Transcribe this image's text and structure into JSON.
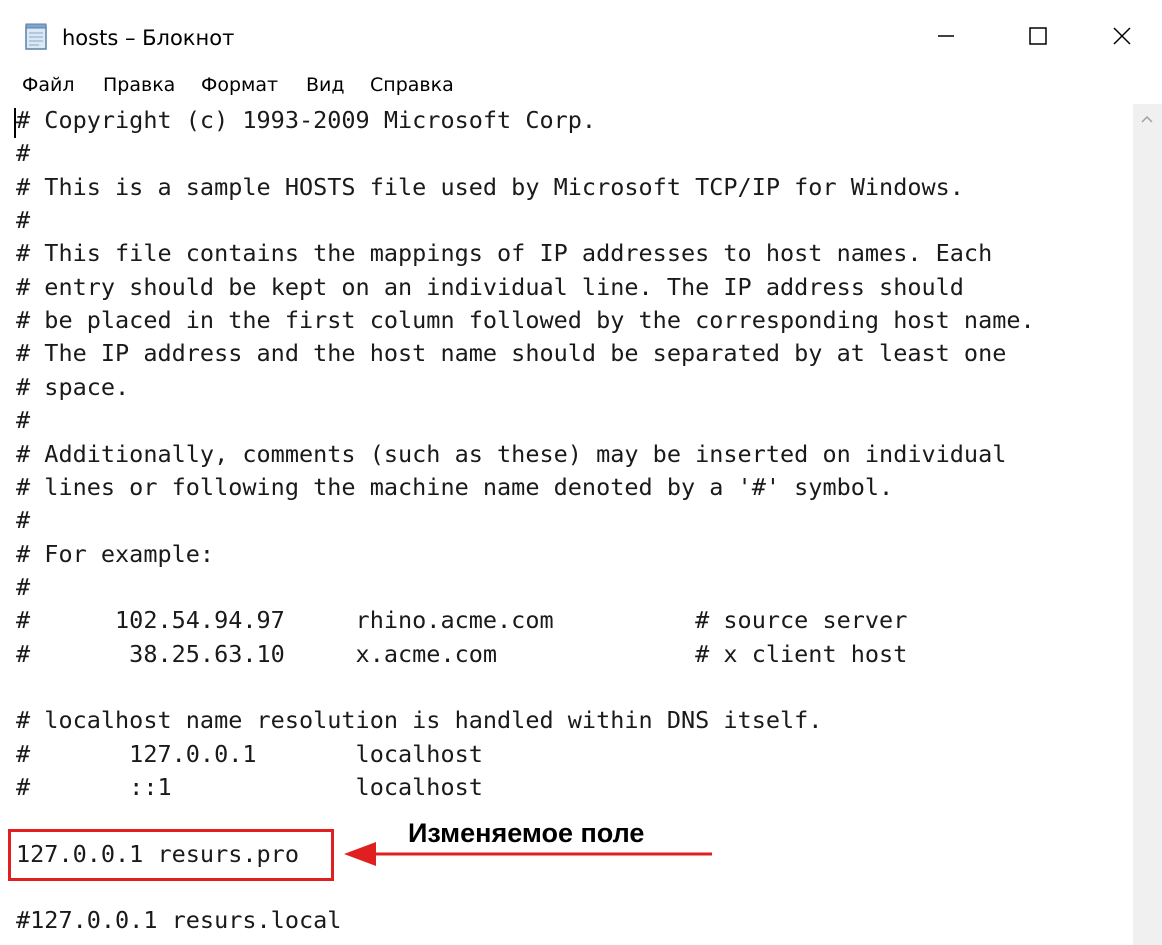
{
  "window": {
    "title": "hosts – Блокнот",
    "icon": "notepad-icon",
    "controls": [
      "minimize-icon",
      "maximize-icon",
      "close-icon"
    ]
  },
  "menu": [
    "Файл",
    "Правка",
    "Формат",
    "Вид",
    "Справка"
  ],
  "lines": [
    "# Copyright (c) 1993-2009 Microsoft Corp.",
    "#",
    "# This is a sample HOSTS file used by Microsoft TCP/IP for Windows.",
    "#",
    "# This file contains the mappings of IP addresses to host names. Each",
    "# entry should be kept on an individual line. The IP address should",
    "# be placed in the first column followed by the corresponding host name.",
    "# The IP address and the host name should be separated by at least one",
    "# space.",
    "#",
    "# Additionally, comments (such as these) may be inserted on individual",
    "# lines or following the machine name denoted by a '#' symbol.",
    "#",
    "# For example:",
    "#",
    "#      102.54.94.97     rhino.acme.com          # source server",
    "#       38.25.63.10     x.acme.com              # x client host",
    "",
    "# localhost name resolution is handled within DNS itself.",
    "#       127.0.0.1       localhost",
    "#       ::1             localhost",
    "",
    "127.0.0.1 resurs.pro",
    "",
    "#127.0.0.1 resurs.local"
  ],
  "annotation": {
    "label": "Изменяемое поле",
    "color": "#e02020"
  }
}
